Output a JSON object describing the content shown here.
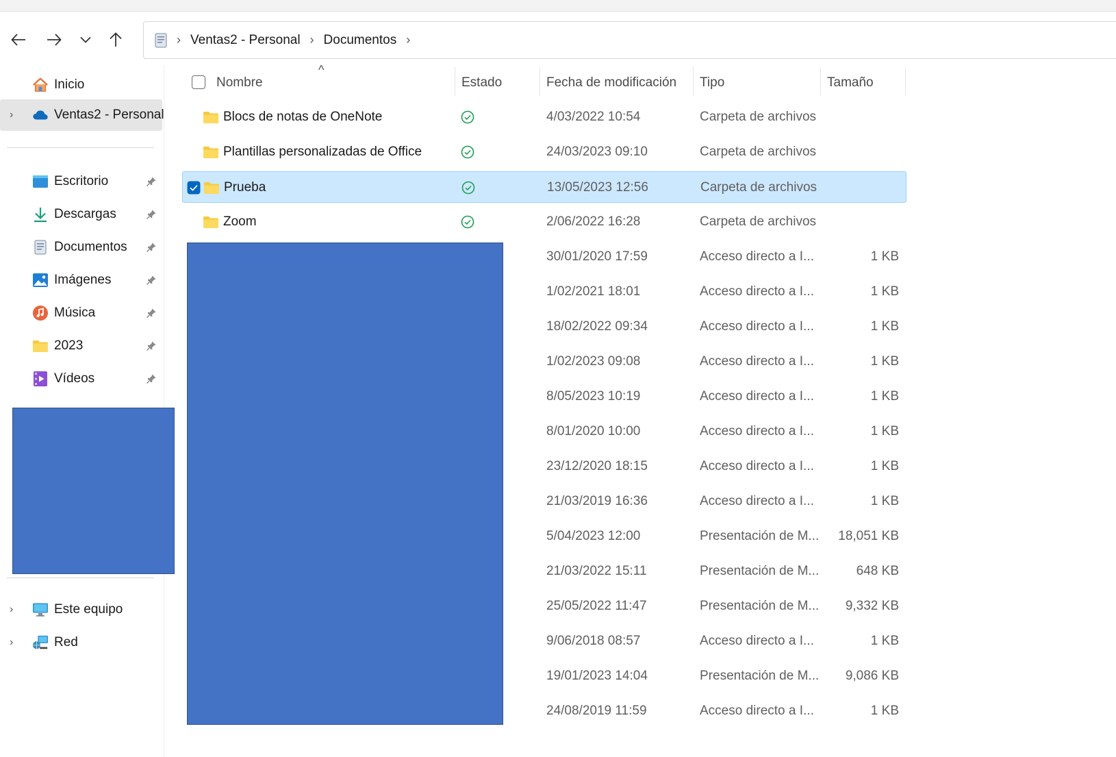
{
  "breadcrumb": {
    "items": [
      "Ventas2 - Personal",
      "Documentos"
    ],
    "trailing_separator": "›"
  },
  "icons": {
    "back": "arrow-left-icon",
    "forward": "arrow-right-icon",
    "recent": "chevron-down-icon",
    "up": "arrow-up-icon",
    "folder": "folder-icon",
    "status": "synced-check-icon",
    "pin": "pin-icon"
  },
  "sidebar": {
    "top": [
      {
        "label": "Inicio",
        "icon": "home-icon",
        "expandable": false,
        "selected": false
      },
      {
        "label": "Ventas2 - Personal",
        "icon": "onedrive-cloud-icon",
        "expandable": true,
        "selected": true
      }
    ],
    "pinned": [
      {
        "label": "Escritorio",
        "icon": "desktop-icon"
      },
      {
        "label": "Descargas",
        "icon": "download-icon"
      },
      {
        "label": "Documentos",
        "icon": "document-icon"
      },
      {
        "label": "Imágenes",
        "icon": "pictures-icon"
      },
      {
        "label": "Música",
        "icon": "music-icon"
      },
      {
        "label": "2023",
        "icon": "folder-icon"
      },
      {
        "label": "Vídeos",
        "icon": "videos-icon"
      }
    ],
    "bottom": [
      {
        "label": "Este equipo",
        "icon": "computer-icon"
      },
      {
        "label": "Red",
        "icon": "network-icon"
      }
    ]
  },
  "columns": {
    "name": "Nombre",
    "status": "Estado",
    "date": "Fecha de modificación",
    "type": "Tipo",
    "size": "Tamaño",
    "sort_indicator": "^"
  },
  "rows": [
    {
      "name": "Blocs de notas de OneNote",
      "status": "synced",
      "date": "4/03/2022 10:54",
      "type": "Carpeta de archivos",
      "size": "",
      "folder": true,
      "selected": false
    },
    {
      "name": "Plantillas personalizadas de Office",
      "status": "synced",
      "date": "24/03/2023 09:10",
      "type": "Carpeta de archivos",
      "size": "",
      "folder": true,
      "selected": false
    },
    {
      "name": "Prueba",
      "status": "synced",
      "date": "13/05/2023 12:56",
      "type": "Carpeta de archivos",
      "size": "",
      "folder": true,
      "selected": true
    },
    {
      "name": "Zoom",
      "status": "synced",
      "date": "2/06/2022 16:28",
      "type": "Carpeta de archivos",
      "size": "",
      "folder": true,
      "selected": false
    },
    {
      "name": "",
      "status": "",
      "date": "30/01/2020 17:59",
      "type": "Acceso directo a I...",
      "size": "1 KB",
      "folder": false,
      "selected": false
    },
    {
      "name": "",
      "status": "",
      "date": "1/02/2021 18:01",
      "type": "Acceso directo a I...",
      "size": "1 KB",
      "folder": false,
      "selected": false
    },
    {
      "name": "",
      "status": "",
      "date": "18/02/2022 09:34",
      "type": "Acceso directo a I...",
      "size": "1 KB",
      "folder": false,
      "selected": false
    },
    {
      "name": "",
      "status": "",
      "date": "1/02/2023 09:08",
      "type": "Acceso directo a I...",
      "size": "1 KB",
      "folder": false,
      "selected": false
    },
    {
      "name": "",
      "status": "",
      "date": "8/05/2023 10:19",
      "type": "Acceso directo a I...",
      "size": "1 KB",
      "folder": false,
      "selected": false
    },
    {
      "name": "",
      "status": "",
      "date": "8/01/2020 10:00",
      "type": "Acceso directo a I...",
      "size": "1 KB",
      "folder": false,
      "selected": false
    },
    {
      "name": "",
      "status": "",
      "date": "23/12/2020 18:15",
      "type": "Acceso directo a I...",
      "size": "1 KB",
      "folder": false,
      "selected": false
    },
    {
      "name": "",
      "status": "",
      "date": "21/03/2019 16:36",
      "type": "Acceso directo a I...",
      "size": "1 KB",
      "folder": false,
      "selected": false
    },
    {
      "name": "",
      "status": "",
      "date": "5/04/2023 12:00",
      "type": "Presentación de M...",
      "size": "18,051 KB",
      "folder": false,
      "selected": false
    },
    {
      "name": "",
      "status": "",
      "date": "21/03/2022 15:11",
      "type": "Presentación de M...",
      "size": "648 KB",
      "folder": false,
      "selected": false
    },
    {
      "name": "",
      "status": "",
      "date": "25/05/2022 11:47",
      "type": "Presentación de M...",
      "size": "9,332 KB",
      "folder": false,
      "selected": false
    },
    {
      "name": "",
      "status": "",
      "date": "9/06/2018 08:57",
      "type": "Acceso directo a I...",
      "size": "1 KB",
      "folder": false,
      "selected": false
    },
    {
      "name": "",
      "status": "",
      "date": "19/01/2023 14:04",
      "type": "Presentación de M...",
      "size": "9,086 KB",
      "folder": false,
      "selected": false
    },
    {
      "name": "",
      "status": "",
      "date": "24/08/2019 11:59",
      "type": "Acceso directo a I...",
      "size": "1 KB",
      "folder": false,
      "selected": false
    }
  ],
  "colors": {
    "selection_bg": "#cce8ff",
    "selection_border": "#99d1ff",
    "accent": "#0067c0",
    "status_green": "#1f9d55",
    "redaction": "#4472c4",
    "folder_yellow": "#f8c93e"
  }
}
